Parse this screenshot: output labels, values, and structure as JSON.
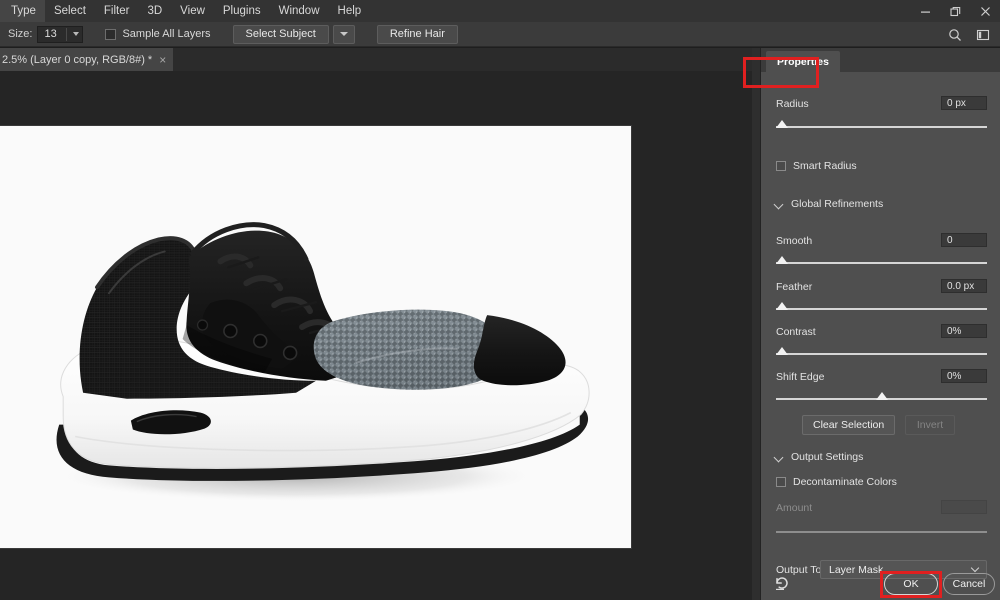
{
  "menubar": {
    "items": [
      {
        "label": "Type"
      },
      {
        "label": "Select"
      },
      {
        "label": "Filter"
      },
      {
        "label": "3D"
      },
      {
        "label": "View"
      },
      {
        "label": "Plugins"
      },
      {
        "label": "Window"
      },
      {
        "label": "Help"
      }
    ],
    "window_controls": {
      "minimize": "minimize-icon",
      "restore": "restore-icon",
      "close": "close-icon"
    }
  },
  "options_bar": {
    "size_label": "Size:",
    "size_value": "13",
    "sample_all_layers": {
      "label": "Sample All Layers",
      "checked": false
    },
    "select_subject": "Select Subject",
    "select_subject_dropdown": "chevron-down-icon",
    "refine_hair": "Refine Hair",
    "search_icon": "search-icon",
    "workspace_icon": "workspace-layout-icon"
  },
  "document_tab": {
    "title": "2.5% (Layer 0 copy, RGB/8#) *",
    "close": "×"
  },
  "canvas": {
    "background_color": "#252525",
    "artboard_color": "#fafafa",
    "image_subject": "black-grey-knit-basketball-sneaker"
  },
  "properties_panel": {
    "tab_label": "Properties",
    "edge_detection": {
      "radius": {
        "label": "Radius",
        "value": "0 px",
        "slider_percent": 0
      }
    },
    "smart_radius": {
      "label": "Smart Radius",
      "checked": false
    },
    "global_refinements": {
      "label": "Global Refinements",
      "sliders": [
        {
          "label": "Smooth",
          "value": "0",
          "slider_percent": 0
        },
        {
          "label": "Feather",
          "value": "0.0 px",
          "slider_percent": 0
        },
        {
          "label": "Contrast",
          "value": "0%",
          "slider_percent": 0
        },
        {
          "label": "Shift Edge",
          "value": "0%",
          "slider_percent": 50
        }
      ],
      "clear_selection": "Clear Selection",
      "invert": "Invert",
      "invert_disabled": true
    },
    "output_settings": {
      "label": "Output Settings",
      "decontaminate_colors": {
        "label": "Decontaminate Colors",
        "checked": false
      },
      "amount": {
        "label": "Amount",
        "value": "",
        "disabled": true,
        "slider_percent": 0
      },
      "output_to": {
        "label": "Output To",
        "value": "Layer Mask"
      }
    },
    "footer": {
      "reset_icon": "reset-icon",
      "ok": "OK",
      "cancel": "Cancel"
    }
  },
  "annotations": {
    "highlight_color": "#e02020",
    "targets": [
      "properties-tab",
      "ok-button"
    ]
  }
}
